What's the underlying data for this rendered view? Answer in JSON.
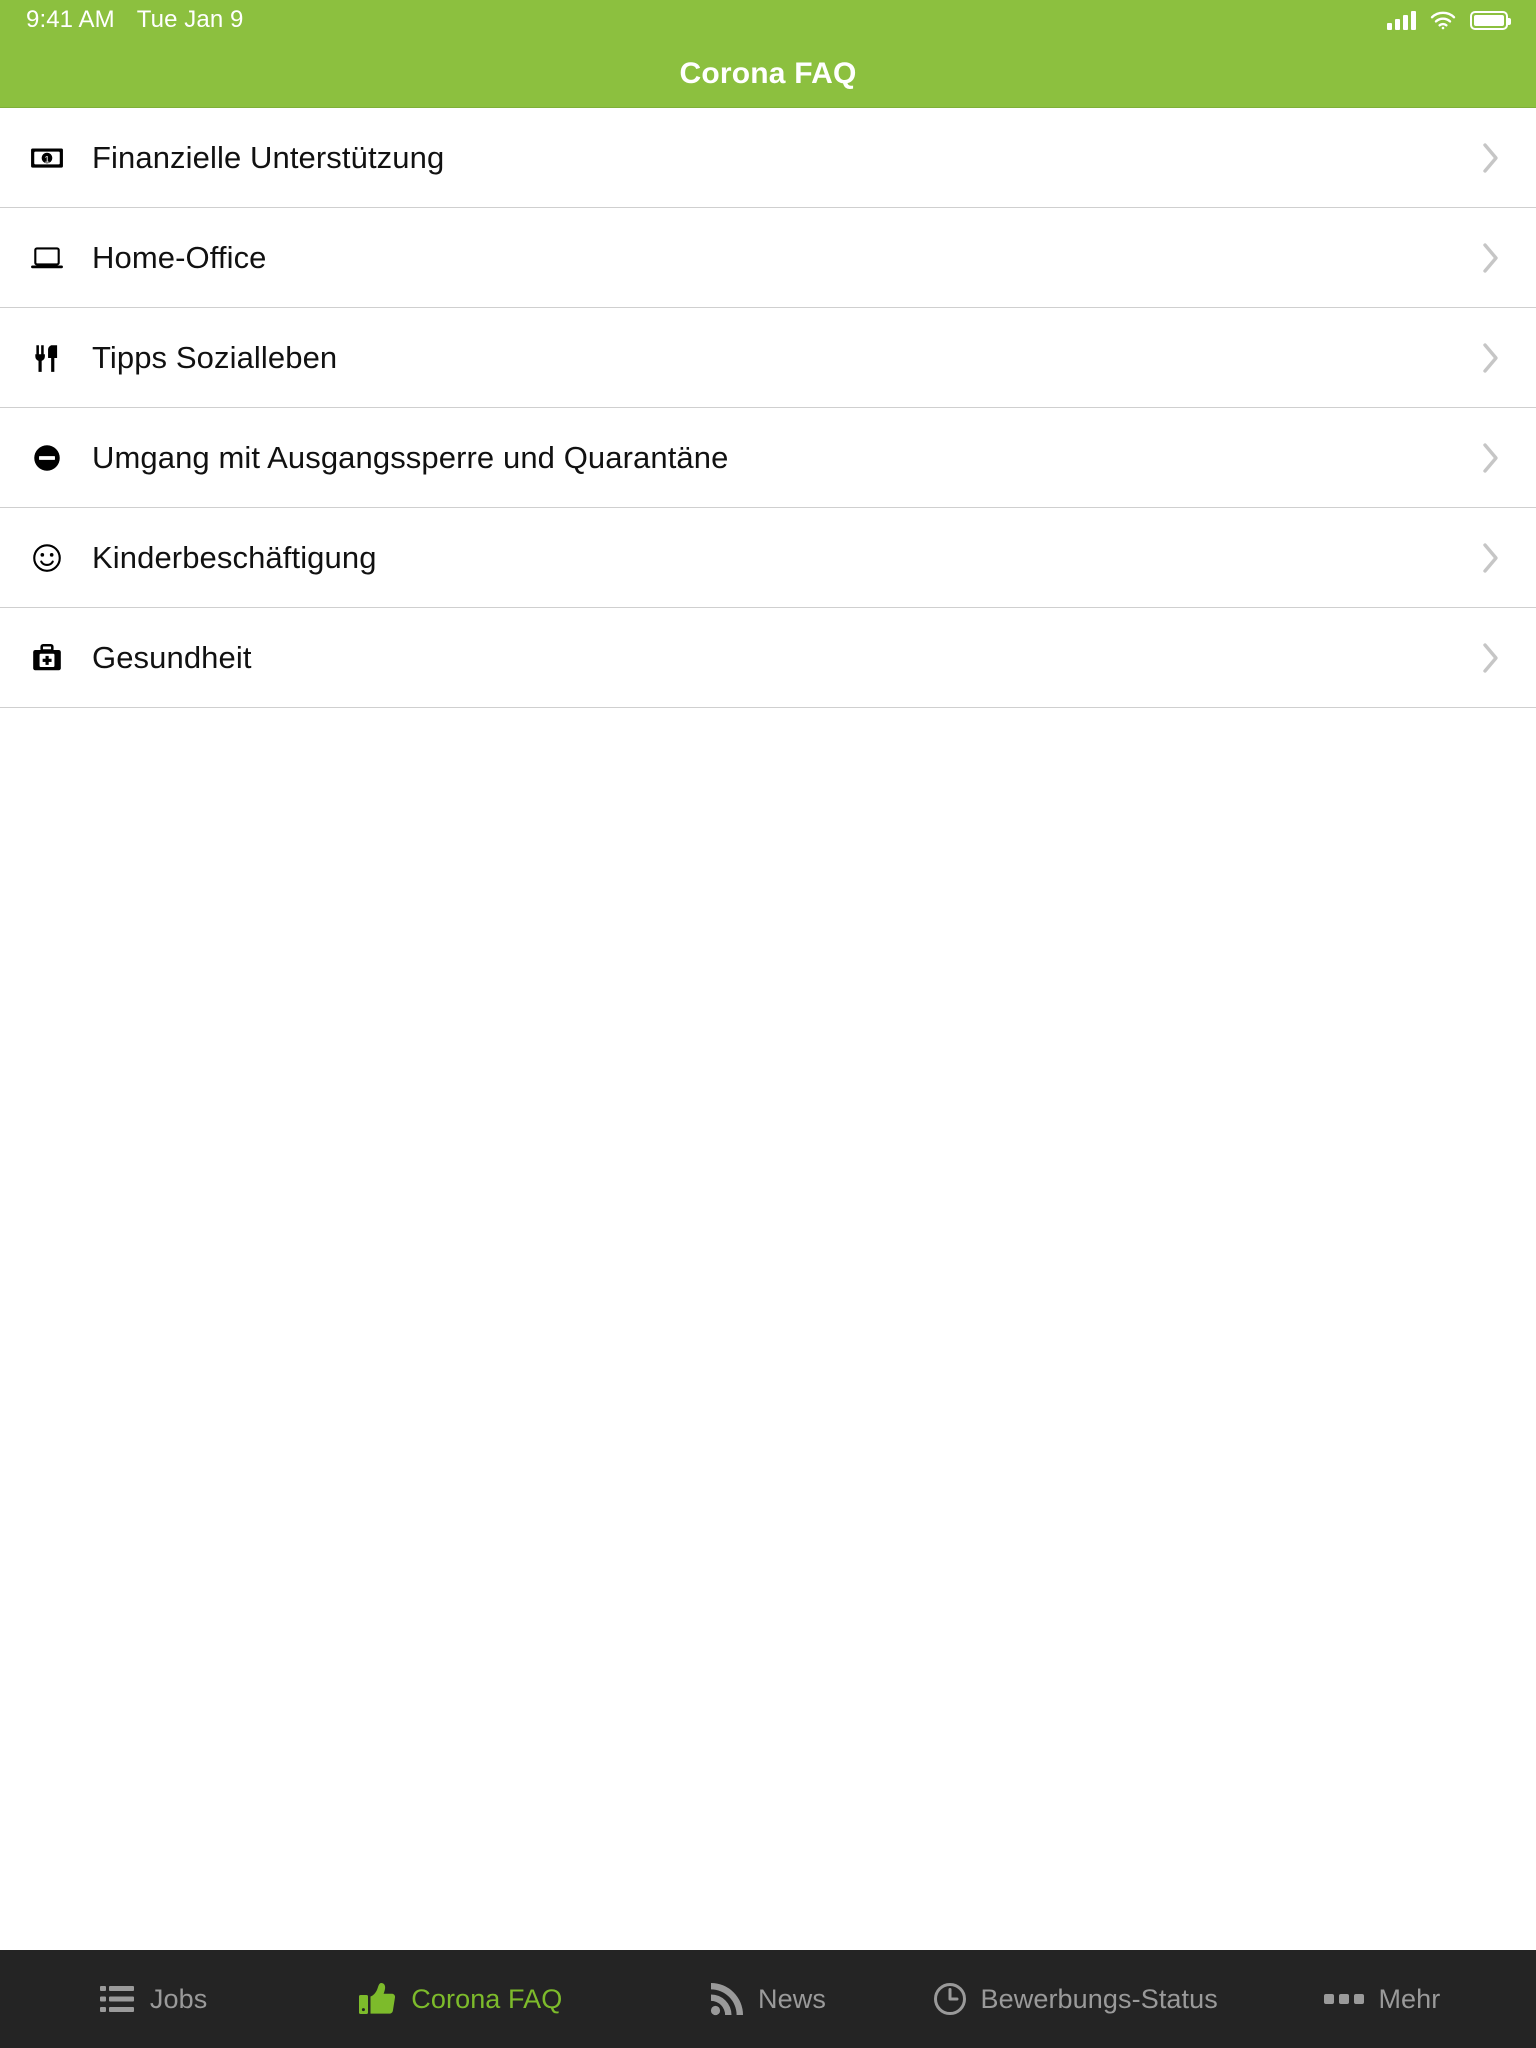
{
  "statusbar": {
    "time": "9:41 AM",
    "date": "Tue Jan 9",
    "signal_icon": "cellular-signal-icon",
    "wifi_icon": "wifi-icon",
    "battery_icon": "battery-full-icon"
  },
  "navbar": {
    "title": "Corona FAQ"
  },
  "list": {
    "items": [
      {
        "label": "Finanzielle Unterstützung",
        "icon": "banknote-icon",
        "chevron": "chevron-right-icon"
      },
      {
        "label": "Home-Office",
        "icon": "laptop-icon",
        "chevron": "chevron-right-icon"
      },
      {
        "label": "Tipps Sozialleben",
        "icon": "fork-knife-icon",
        "chevron": "chevron-right-icon"
      },
      {
        "label": "Umgang mit Ausgangssperre und Quarantäne",
        "icon": "minus-circle-icon",
        "chevron": "chevron-right-icon"
      },
      {
        "label": "Kinderbeschäftigung",
        "icon": "smiley-face-icon",
        "chevron": "chevron-right-icon"
      },
      {
        "label": "Gesundheit",
        "icon": "first-aid-kit-icon",
        "chevron": "chevron-right-icon"
      }
    ]
  },
  "tabbar": {
    "tabs": [
      {
        "label": "Jobs",
        "icon": "list-icon",
        "active": false
      },
      {
        "label": "Corona FAQ",
        "icon": "thumbs-up-icon",
        "active": true
      },
      {
        "label": "News",
        "icon": "rss-feed-icon",
        "active": false
      },
      {
        "label": "Bewerbungs-Status",
        "icon": "clock-icon",
        "active": false
      },
      {
        "label": "Mehr",
        "icon": "ellipsis-icon",
        "active": false
      }
    ]
  },
  "colors": {
    "brand_green": "#8CC03F",
    "tab_active_green": "#7DBB2B",
    "tabbar_background": "#242424",
    "separator": "#cfcfcf",
    "chevron": "#c6c6c6"
  }
}
